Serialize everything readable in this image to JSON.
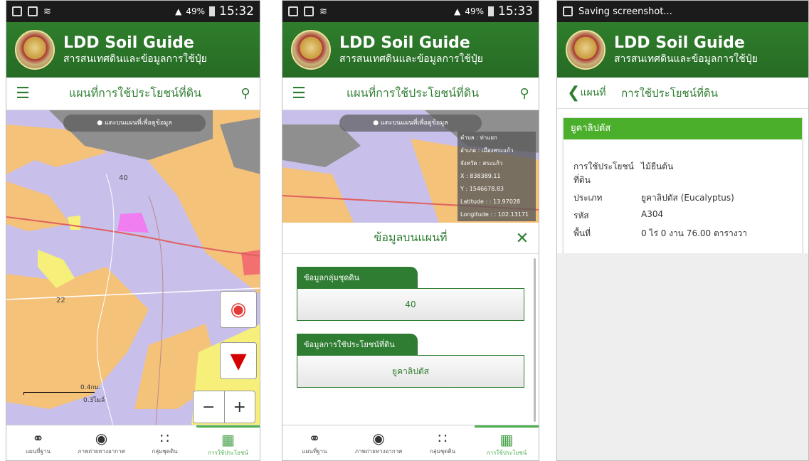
{
  "app": {
    "title": "LDD Soil Guide",
    "subtitle": "สารสนเทศดินและข้อมูลการใช้ปุ๋ย"
  },
  "screen1": {
    "status": {
      "battery": "49%",
      "time": "15:32"
    },
    "toolbar_title": "แผนที่การใช้ประโยชน์ที่ดิน",
    "map_hint": "● แตะบนแผนที่เพื่อดูข้อมูล",
    "map_labels": [
      "40",
      "22"
    ],
    "scale": {
      "km": "0.4กม.",
      "mi": "0.3ไมล์"
    },
    "zoom": {
      "minus": "−",
      "plus": "+"
    }
  },
  "screen2": {
    "status": {
      "battery": "49%",
      "time": "15:33"
    },
    "toolbar_title": "แผนที่การใช้ประโยชน์ที่ดิน",
    "map_hint": "● แตะบนแผนที่เพื่อดูข้อมูล",
    "info": [
      "ตำบล : ท่าแยก",
      "อำเภอ : เมืองสระแก้ว",
      "จังหวัด : สระแก้ว",
      "X : 838389.11",
      "Y : 1546678.83",
      "Latitude : : 13.97028",
      "Longitude : : 102.13171"
    ],
    "sheet_title": "ข้อมูลบนแผนที่",
    "soil_label": "ข้อมูลกลุ่มชุดดิน",
    "soil_value": "40",
    "landuse_label": "ข้อมูลการใช้ประโยชน์ที่ดิน",
    "landuse_value": "ยูคาลิปตัส"
  },
  "screen3": {
    "status_text": "Saving screenshot...",
    "back_label": "แผนที่",
    "title": "การใช้ประโยชน์ที่ดิน",
    "card_header": "ยูคาลิปตัส",
    "rows": [
      {
        "k": "การใช้ประโยชน์ที่ดิน",
        "v": "ไม้ยืนต้น"
      },
      {
        "k": "ประเภท",
        "v": "ยูคาลิปตัส (Eucalyptus)"
      },
      {
        "k": "รหัส",
        "v": "A304"
      },
      {
        "k": "พื้นที่",
        "v": "0 ไร่ 0 งาน 76.00 ตารางวา"
      }
    ]
  },
  "tabs": [
    {
      "label": "แผนที่ฐาน",
      "icon": "globe-grid-icon"
    },
    {
      "label": "ภาพถ่ายทางอากาศ",
      "icon": "earth-icon"
    },
    {
      "label": "กลุ่มชุดดิน",
      "icon": "dots-grid-icon"
    },
    {
      "label": "การใช้ประโยชน์",
      "icon": "grid-table-icon"
    }
  ],
  "colors": {
    "primary": "#2e7d32",
    "accent": "#4caf50",
    "map_purple": "#c8c0ea",
    "map_orange": "#f5c27a"
  }
}
